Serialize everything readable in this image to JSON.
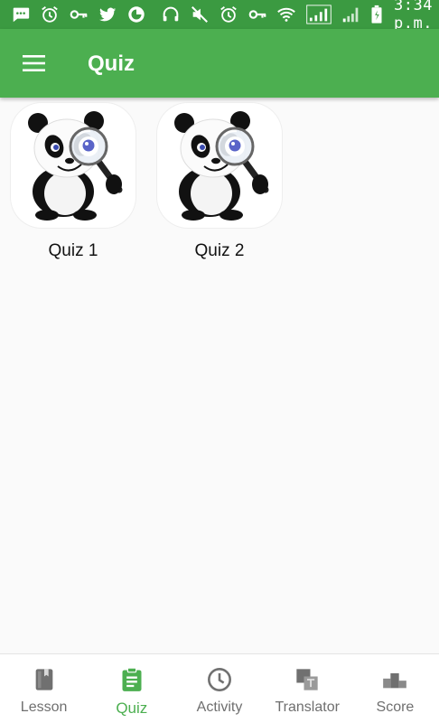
{
  "status_bar": {
    "left_icons": [
      "message-icon",
      "alarm-icon",
      "key-icon",
      "twitter-icon",
      "firefox-icon"
    ],
    "right_icons": [
      "headset-icon",
      "mute-icon",
      "alarm-icon",
      "key-icon",
      "wifi-icon",
      "signal-icon",
      "signal-icon",
      "battery-icon"
    ],
    "time": "3:34 p.m."
  },
  "app_bar": {
    "title": "Quiz"
  },
  "quizzes": [
    {
      "label": "Quiz 1"
    },
    {
      "label": "Quiz 2"
    }
  ],
  "bottom_nav": {
    "active_index": 1,
    "active_color": "#4caf50",
    "inactive_color": "#6f6f6f",
    "items": [
      {
        "label": "Lesson",
        "icon": "book-icon"
      },
      {
        "label": "Quiz",
        "icon": "clipboard-icon"
      },
      {
        "label": "Activity",
        "icon": "clock-icon"
      },
      {
        "label": "Translator",
        "icon": "translate-icon"
      },
      {
        "label": "Score",
        "icon": "podium-icon"
      }
    ]
  },
  "colors": {
    "status_bar": "#3b9a41",
    "app_bar": "#4caf50",
    "background": "#fafafa"
  }
}
